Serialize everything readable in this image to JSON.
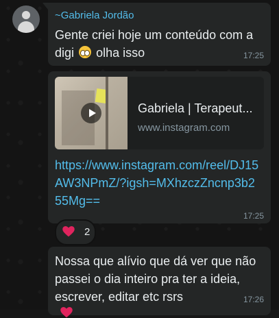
{
  "messages": [
    {
      "sender": "~Gabriela Jordão",
      "text_before_emoji": "Gente criei hoje um conteúdo com a digi",
      "emoji": "pleading-face-emoji",
      "text_after_emoji": "olha isso",
      "time": "17:25"
    },
    {
      "preview_title": "Gabriela | Terapeut...",
      "preview_domain": "www.instagram.com",
      "link": "https://www.instagram.com/reel/DJ15AW3NPmZ/?igsh=MXhzczZncnp3b255Mg==",
      "time": "17:25",
      "reaction": {
        "emoji": "red-heart",
        "count": "2"
      }
    },
    {
      "text": "Nossa que alívio que dá ver que não passei o dia inteiro pra ter a ideia, escrever, editar etc rsrs",
      "time": "17:26"
    }
  ],
  "colors": {
    "bubble": "#242626",
    "sender": "#53bdeb",
    "link": "#53bdeb",
    "text": "#e9edef",
    "time": "#8696a0",
    "heart": "#e0245e"
  }
}
